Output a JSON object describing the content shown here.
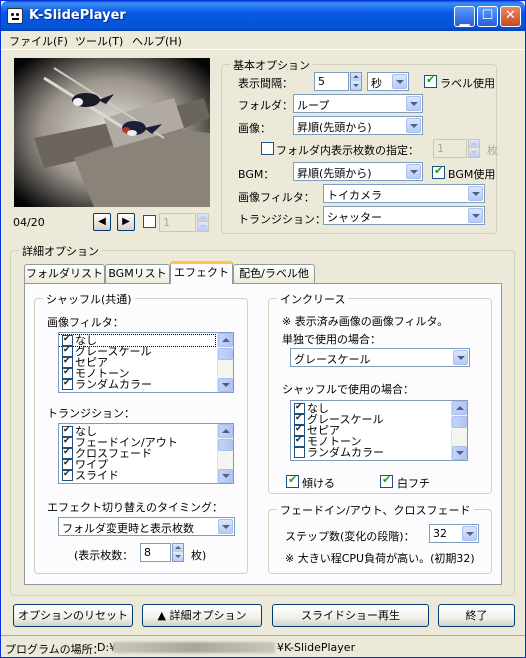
{
  "window": {
    "title": "K-SlidePlayer",
    "minimize_icon": "minimize-icon",
    "maximize_icon": "maximize-icon",
    "close_icon": "close-icon"
  },
  "menu": [
    "ファイル(F)",
    "ツール(T)",
    "ヘルプ(H)"
  ],
  "preview": {
    "counter": "04/20",
    "prev_icon": "prev-icon",
    "next_icon": "next-icon",
    "page_value": "1"
  },
  "basic": {
    "title": "基本オプション",
    "interval_label": "表示間隔：",
    "interval_value": "5",
    "interval_unit": "秒",
    "use_label": "ラベル使用",
    "folder_label": "フォルダ：",
    "folder_value": "ループ",
    "image_label": "画像：",
    "image_value": "昇順(先頭から)",
    "folder_count_label": "フォルダ内表示枚数の指定：",
    "folder_count_value": "1",
    "folder_count_unit": "枚",
    "bgm_label": "BGM：",
    "bgm_value": "昇順(先頭から)",
    "bgm_use_label": "BGM使用",
    "filter_label": "画像フィルタ：",
    "filter_value": "トイカメラ",
    "transition_label": "トランジション：",
    "transition_value": "シャッター"
  },
  "detail": {
    "title": "詳細オプション",
    "tabs": [
      "フォルダリスト",
      "BGMリスト",
      "エフェクト",
      "配色/ラベル他"
    ],
    "shuffle": {
      "title": "シャッフル(共通)",
      "filter_label": "画像フィルタ：",
      "filter_items": [
        "なし",
        "グレースケール",
        "セピア",
        "モノトーン",
        "ランダムカラー"
      ],
      "transition_label": "トランジション：",
      "transition_items": [
        "なし",
        "フェードイン/アウト",
        "クロスフェード",
        "ワイプ",
        "スライド"
      ],
      "timing_label": "エフェクト切り替えのタイミング：",
      "timing_value": "フォルダ変更時と表示枚数",
      "count_label": "(表示枚数：",
      "count_value": "8",
      "count_unit": "枚)"
    },
    "increase": {
      "title": "インクリース",
      "note": "※ 表示済み画像の画像フィルタ。",
      "single_label": "単独で使用の場合：",
      "single_value": "グレースケール",
      "shuffle_label": "シャッフルで使用の場合：",
      "shuffle_items": [
        "なし",
        "グレースケール",
        "セピア",
        "モノトーン",
        "ランダムカラー"
      ],
      "tilt_label": "傾ける",
      "border_label": "白フチ"
    },
    "fade": {
      "title": "フェードイン/アウト、クロスフェード",
      "steps_label": "ステップ数(変化の段階)：",
      "steps_value": "32",
      "note": "※ 大きい程CPU負荷が高い。(初期32)"
    }
  },
  "buttons": {
    "reset": "オプションのリセット",
    "detail": "▲ 詳細オプション",
    "play": "スライドショー再生",
    "exit": "終了"
  },
  "status": {
    "path_label": "プログラムの場所：",
    "path_value": "D:¥",
    "path_suffix": "¥K-SlidePlayer"
  },
  "colors": {
    "titlebar": "#0a5fd8",
    "face": "#ece9d8",
    "tab_highlight": "#ffc83c",
    "check": "#21a121"
  }
}
